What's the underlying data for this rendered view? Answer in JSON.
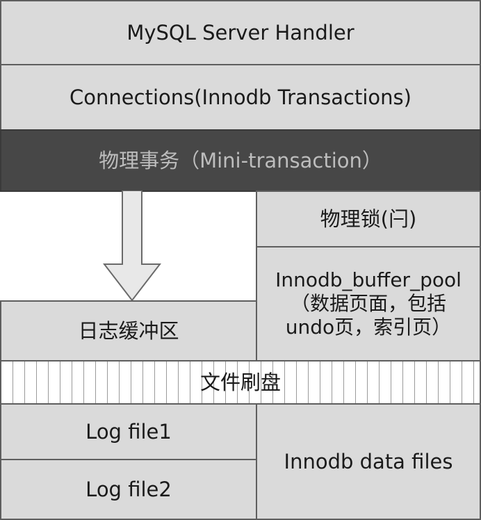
{
  "diagram": {
    "handler": "MySQL Server Handler",
    "connections": "Connections(Innodb Transactions)",
    "mini_transaction": "物理事务（Mini-transaction）",
    "physical_lock": "物理锁(闩)",
    "buffer_pool": {
      "line1": "Innodb_buffer_pool",
      "line2": "（数据页面，包括",
      "line3": "undo页，索引页）"
    },
    "log_buffer": "日志缓冲区",
    "flush": "文件刷盘",
    "log_file1": "Log file1",
    "log_file2": "Log file2",
    "data_files": "Innodb data files",
    "arrow_icon": "down-arrow-icon",
    "colors": {
      "light_grey": "#dadada",
      "dark_grey": "#474747",
      "border": "#5e5e5e"
    }
  }
}
